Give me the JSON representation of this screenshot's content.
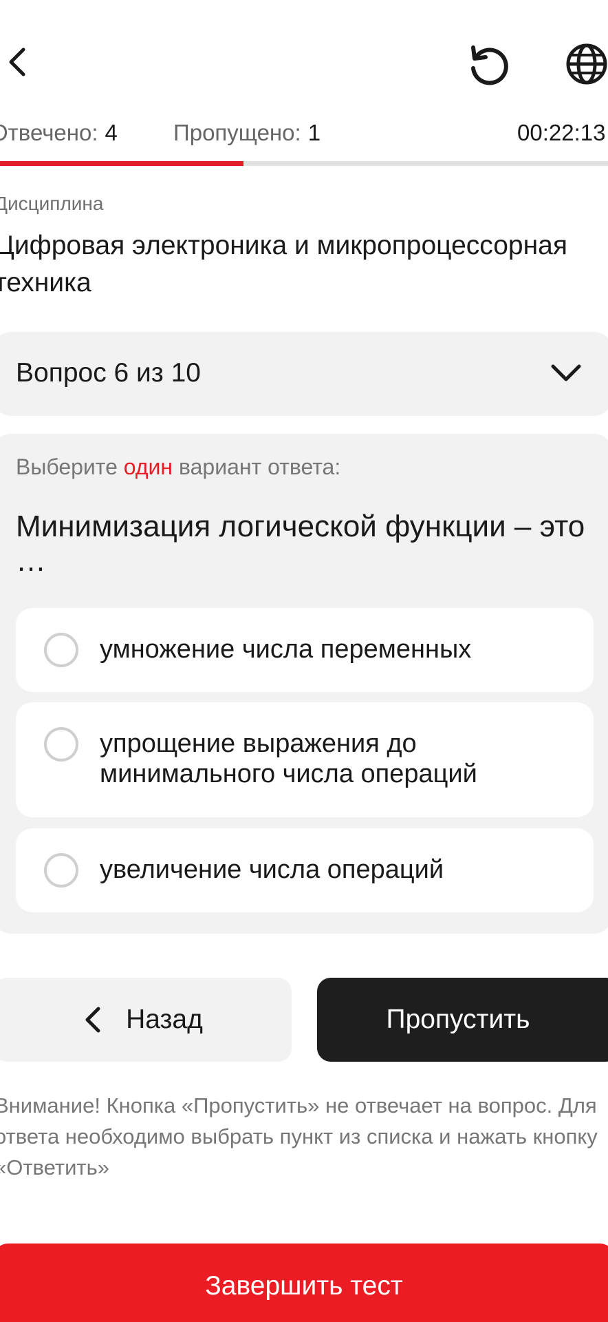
{
  "header": {
    "back_icon": "chevron-left-icon",
    "reset_icon": "reset-icon",
    "language_icon": "globe-icon"
  },
  "stats": {
    "answered_label": "Отвечено:",
    "answered_value": "4",
    "skipped_label": "Пропущено:",
    "skipped_value": "1",
    "timer": "00:22:13"
  },
  "progress": {
    "fraction": 0.4,
    "fill_color": "#e31e24",
    "track_color": "#e2e2e2"
  },
  "discipline": {
    "label": "Дисциплина",
    "title": "Цифровая электроника и микропроцессорная техника"
  },
  "question_selector": {
    "label": "Вопрос 6 из 10",
    "icon": "chevron-down-icon"
  },
  "question": {
    "instruction_prefix": "Выберите",
    "instruction_accent": "один",
    "instruction_suffix": "вариант ответа:",
    "text": "Минимизация логической функции – это …",
    "options": [
      {
        "label": "умножение числа переменных"
      },
      {
        "label": "упрощение выражения до минимального числа операций"
      },
      {
        "label": "увеличение числа операций"
      }
    ]
  },
  "buttons": {
    "back_label": "Назад",
    "skip_label": "Пропустить",
    "finish_label": "Завершить тест"
  },
  "notice": "Внимание! Кнопка «Пропустить» не отвечает на вопрос. Для ответа необходимо выбрать пункт из списка и нажать кнопку «Ответить»",
  "colors": {
    "accent": "#e31e24",
    "dark_button": "#1e1e1e",
    "card_bg": "#f2f2f2"
  }
}
